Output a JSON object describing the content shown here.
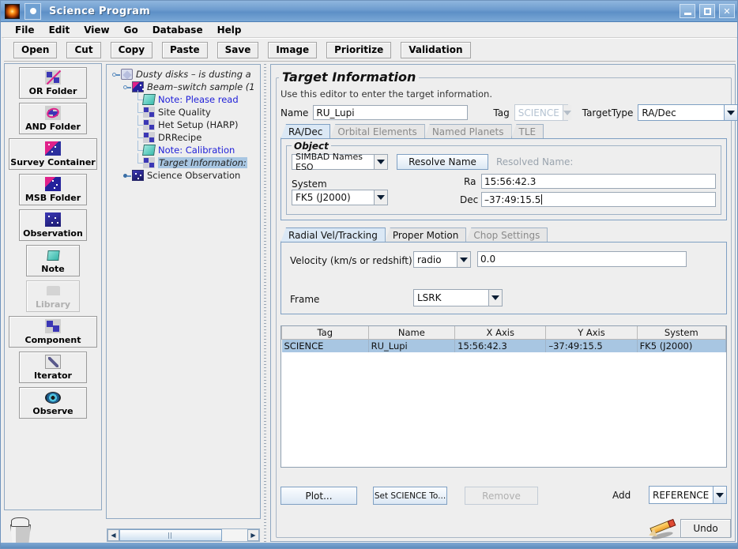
{
  "window": {
    "title": "Science Program",
    "minimize_label": "_",
    "maximize_label": "□",
    "close_label": "✕"
  },
  "menubar": {
    "items": [
      "File",
      "Edit",
      "View",
      "Go",
      "Database",
      "Help"
    ]
  },
  "toolbar": {
    "buttons": [
      "Open",
      "Cut",
      "Copy",
      "Paste",
      "Save",
      "Image",
      "Prioritize",
      "Validation"
    ]
  },
  "palette": {
    "items": [
      {
        "label": "OR Folder",
        "icon": "or-folder-icon",
        "enabled": true
      },
      {
        "label": "AND Folder",
        "icon": "and-folder-icon",
        "enabled": true
      },
      {
        "label": "Survey Container",
        "icon": "survey-container-icon",
        "enabled": true
      },
      {
        "label": "MSB Folder",
        "icon": "msb-folder-icon",
        "enabled": true
      },
      {
        "label": "Observation",
        "icon": "observation-icon",
        "enabled": true
      },
      {
        "label": "Note",
        "icon": "note-icon",
        "enabled": true
      },
      {
        "label": "Library",
        "icon": "library-icon",
        "enabled": false
      },
      {
        "label": "Component",
        "icon": "component-icon",
        "enabled": true
      },
      {
        "label": "Iterator",
        "icon": "iterator-icon",
        "enabled": true
      },
      {
        "label": "Observe",
        "icon": "observe-eye-icon",
        "enabled": true
      }
    ],
    "trash_icon": "trash-icon"
  },
  "tree": {
    "nodes": [
      {
        "label": "Dusty disks – is dusting a",
        "icon": "program-root-icon",
        "style": "italic",
        "depth": 0
      },
      {
        "label": "Beam–switch sample (1",
        "icon": "msb-folder-icon",
        "style": "italic",
        "depth": 1
      },
      {
        "label": "Note: Please read",
        "icon": "note-icon",
        "style": "blue",
        "depth": 2
      },
      {
        "label": "Site Quality",
        "icon": "component-icon",
        "style": "plain",
        "depth": 2
      },
      {
        "label": "Het Setup (HARP)",
        "icon": "component-icon",
        "style": "plain",
        "depth": 2
      },
      {
        "label": "DRRecipe",
        "icon": "component-icon",
        "style": "plain",
        "depth": 2
      },
      {
        "label": "Note: Calibration",
        "icon": "note-icon",
        "style": "blue",
        "depth": 2
      },
      {
        "label": "Target Information:",
        "icon": "component-icon",
        "style": "selected",
        "depth": 2
      },
      {
        "label": "Science Observation",
        "icon": "observation-icon",
        "style": "plain",
        "depth": 1
      }
    ],
    "hscroll": {
      "left_arrow": "◀",
      "right_arrow": "▶"
    }
  },
  "editor": {
    "title": "Target Information",
    "hint": "Use this editor to enter the target information.",
    "name_label": "Name",
    "name_value": "RU_Lupi",
    "tag_label": "Tag",
    "tag_value": "SCIENCE",
    "target_type_label": "TargetType",
    "target_type_value": "RA/Dec",
    "target_tabs": [
      {
        "label": "RA/Dec",
        "state": "active"
      },
      {
        "label": "Orbital Elements",
        "state": "disabled"
      },
      {
        "label": "Named Planets",
        "state": "disabled"
      },
      {
        "label": "TLE",
        "state": "disabled"
      }
    ],
    "object_group": {
      "legend": "Object",
      "catalog_value": "SIMBAD Names ESO",
      "resolve_button": "Resolve Name",
      "resolved_name_label": "Resolved Name:",
      "system_label": "System",
      "system_value": "FK5 (J2000)",
      "ra_label": "Ra",
      "ra_value": "15:56:42.3",
      "dec_label": "Dec",
      "dec_value": "–37:49:15.5"
    },
    "motion_tabs": [
      {
        "label": "Radial Vel/Tracking",
        "state": "active"
      },
      {
        "label": "Proper Motion",
        "state": "enabled"
      },
      {
        "label": "Chop Settings",
        "state": "disabled"
      }
    ],
    "radial": {
      "velocity_label": "Velocity (km/s or redshift)",
      "velocity_type": "radio",
      "velocity_value": "0.0",
      "frame_label": "Frame",
      "frame_value": "LSRK"
    },
    "table": {
      "columns": [
        "Tag",
        "Name",
        "X Axis",
        "Y Axis",
        "System"
      ],
      "rows": [
        {
          "cells": [
            "SCIENCE",
            "RU_Lupi",
            "15:56:42.3",
            "–37:49:15.5",
            "FK5 (J2000)"
          ],
          "selected": true
        }
      ]
    },
    "actions": {
      "plot": "Plot...",
      "set_science": "Set SCIENCE To...",
      "remove": "Remove",
      "add_label": "Add",
      "add_value": "REFERENCE"
    }
  },
  "footer": {
    "pencil_icon": "pencil-icon",
    "undo_label": "Undo"
  },
  "colors": {
    "titlebar": "#6c9bce",
    "panel": "#eeeeee",
    "selection": "#a8c6e2",
    "note_text": "#2020d8",
    "field_border": "#9aa7b5"
  }
}
